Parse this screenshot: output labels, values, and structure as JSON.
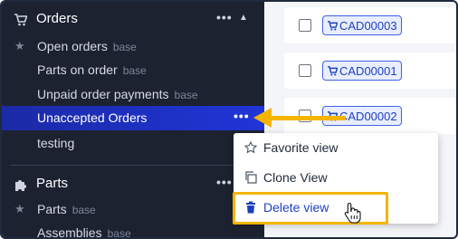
{
  "sidebar": {
    "orders": {
      "title": "Orders",
      "items": [
        {
          "label": "Open orders",
          "badge": "base",
          "starred": true
        },
        {
          "label": "Parts on order",
          "badge": "base",
          "starred": false
        },
        {
          "label": "Unpaid order payments",
          "badge": "base",
          "starred": false
        },
        {
          "label": "Unaccepted Orders",
          "badge": "",
          "starred": false,
          "active": true
        },
        {
          "label": "testing",
          "badge": "",
          "starred": false
        }
      ]
    },
    "parts": {
      "title": "Parts",
      "items": [
        {
          "label": "Parts",
          "badge": "base",
          "starred": true
        },
        {
          "label": "Assemblies",
          "badge": "base",
          "starred": false
        }
      ]
    }
  },
  "orders_list": [
    {
      "code": "CAD00003"
    },
    {
      "code": "CAD00001"
    },
    {
      "code": "CAD00002"
    }
  ],
  "context_menu": {
    "favorite": "Favorite view",
    "clone": "Clone View",
    "delete": "Delete view"
  },
  "colors": {
    "sidebar_bg": "#1d2231",
    "active_item": "#2035d8",
    "accent_highlight": "#f5b400",
    "tag_blue": "#3f62e6"
  }
}
